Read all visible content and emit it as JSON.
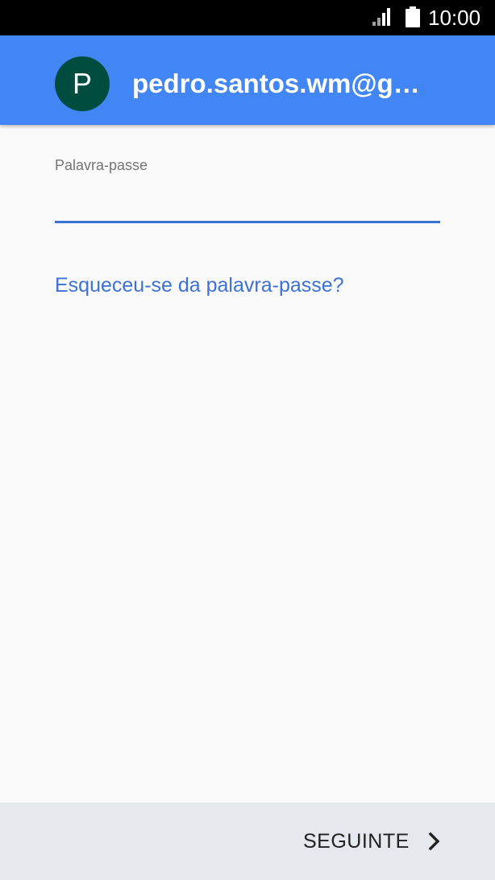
{
  "status_bar": {
    "time": "10:00",
    "signal_icon": "signal-icon",
    "battery_icon": "battery-icon"
  },
  "account": {
    "avatar_initial": "P",
    "email": "pedro.santos.wm@gm…",
    "avatar_color": "#004d40",
    "header_color": "#4285f4"
  },
  "password": {
    "label": "Palavra-passe",
    "value": "",
    "placeholder": ""
  },
  "forgot_link": {
    "label": "Esqueceu-se da palavra-passe?",
    "color": "#3c72d6"
  },
  "footer": {
    "next_label": "SEGUINTE",
    "next_icon": "chevron-right-icon"
  }
}
